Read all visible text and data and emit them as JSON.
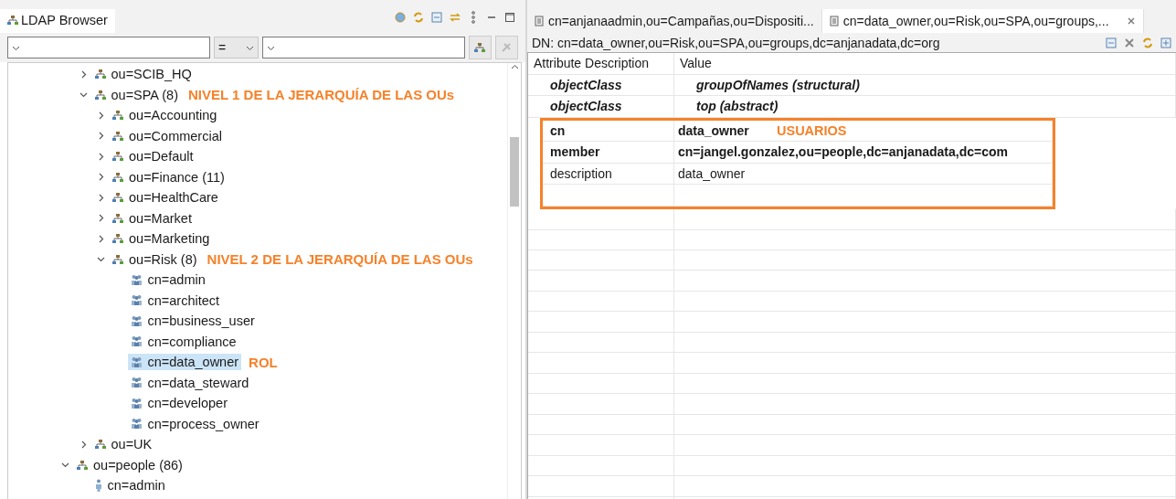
{
  "browser": {
    "title": "LDAP Browser",
    "filter": {
      "operator": "="
    }
  },
  "tree": {
    "items": [
      {
        "children": [
          {
            "kind": "ou",
            "label": "ou=SCIB_HQ",
            "expanded": false,
            "selected": false
          },
          {
            "kind": "ou",
            "label": "ou=SPA (8)",
            "expanded": true,
            "selected": false,
            "note": "NIVEL 1 DE LA JERARQUÍA DE LAS OUs",
            "children": [
              {
                "kind": "ou",
                "label": "ou=Accounting",
                "expanded": false,
                "selected": false
              },
              {
                "kind": "ou",
                "label": "ou=Commercial",
                "expanded": false,
                "selected": false
              },
              {
                "kind": "ou",
                "label": "ou=Default",
                "expanded": false,
                "selected": false
              },
              {
                "kind": "ou",
                "label": "ou=Finance (11)",
                "expanded": false,
                "selected": false
              },
              {
                "kind": "ou",
                "label": "ou=HealthCare",
                "expanded": false,
                "selected": false
              },
              {
                "kind": "ou",
                "label": "ou=Market",
                "expanded": false,
                "selected": false
              },
              {
                "kind": "ou",
                "label": "ou=Marketing",
                "expanded": false,
                "selected": false
              },
              {
                "kind": "ou",
                "label": "ou=Risk (8)",
                "expanded": true,
                "selected": false,
                "note": "NIVEL 2 DE LA JERARQUÍA DE LAS OUs",
                "children": [
                  {
                    "kind": "group",
                    "label": "cn=admin",
                    "selected": false
                  },
                  {
                    "kind": "group",
                    "label": "cn=architect",
                    "selected": false
                  },
                  {
                    "kind": "group",
                    "label": "cn=business_user",
                    "selected": false
                  },
                  {
                    "kind": "group",
                    "label": "cn=compliance",
                    "selected": false
                  },
                  {
                    "kind": "group",
                    "label": "cn=data_owner",
                    "selected": true,
                    "note": "ROL"
                  },
                  {
                    "kind": "group",
                    "label": "cn=data_steward",
                    "selected": false
                  },
                  {
                    "kind": "group",
                    "label": "cn=developer",
                    "selected": false
                  },
                  {
                    "kind": "group",
                    "label": "cn=process_owner",
                    "selected": false
                  }
                ]
              }
            ]
          },
          {
            "kind": "ou",
            "label": "ou=UK",
            "expanded": false,
            "selected": false
          }
        ]
      },
      {
        "kind": "ou",
        "label": "ou=people (86)",
        "expanded": true,
        "selected": false,
        "children": [
          {
            "kind": "person",
            "label": "cn=admin",
            "selected": false
          }
        ]
      }
    ]
  },
  "editor": {
    "tabs": [
      {
        "label": "cn=anjanaadmin,ou=Campañas,ou=Dispositi...",
        "selected": false
      },
      {
        "label": "cn=data_owner,ou=Risk,ou=SPA,ou=groups,...",
        "selected": true
      }
    ],
    "dn": "DN: cn=data_owner,ou=Risk,ou=SPA,ou=groups,dc=anjanadata,dc=org",
    "columns": [
      "Attribute Description",
      "Value"
    ],
    "rows": [
      {
        "kind": "objectclass",
        "attribute": "objectClass",
        "value": "groupOfNames (structural)"
      },
      {
        "kind": "objectclass",
        "attribute": "objectClass",
        "value": "top (abstract)"
      }
    ],
    "boxed": {
      "label": "USUARIOS",
      "rows": [
        {
          "kind": "must",
          "attribute": "cn",
          "value": "data_owner"
        },
        {
          "kind": "must",
          "attribute": "member",
          "value": "cn=jangel.gonzalez,ou=people,dc=anjanadata,dc=com"
        },
        {
          "kind": "may",
          "attribute": "description",
          "value": "data_owner"
        }
      ]
    }
  }
}
